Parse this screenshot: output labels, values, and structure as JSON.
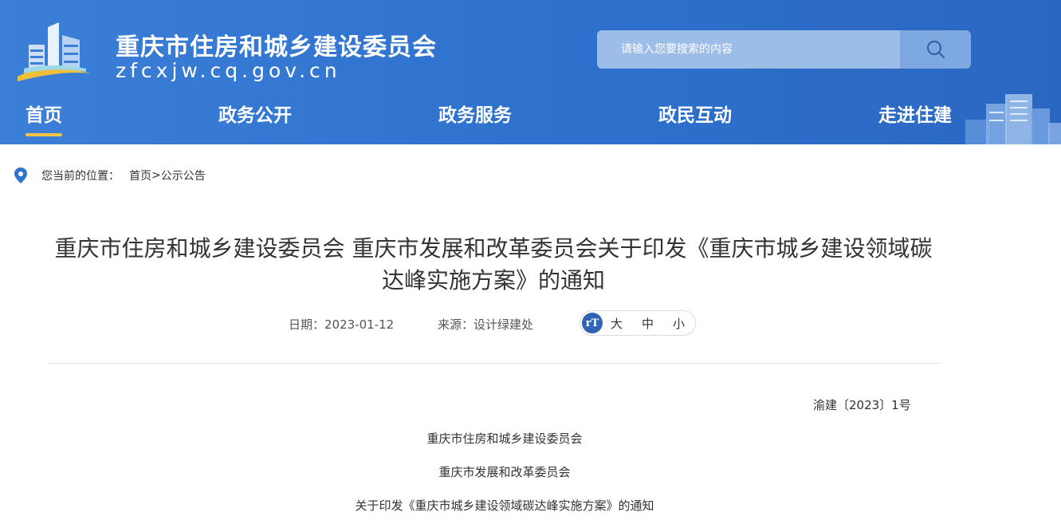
{
  "site": {
    "title": "重庆市住房和城乡建设委员会",
    "domain": "zfcxjw.cq.gov.cn"
  },
  "search": {
    "placeholder": "请输入您要搜索的内容",
    "button_icon": "search-icon"
  },
  "nav": {
    "items": [
      {
        "label": "首页",
        "active": true
      },
      {
        "label": "政务公开",
        "active": false
      },
      {
        "label": "政务服务",
        "active": false
      },
      {
        "label": "政民互动",
        "active": false
      },
      {
        "label": "走进住建",
        "active": false
      }
    ]
  },
  "breadcrumb": {
    "prefix": "您当前的位置：",
    "home": "首页",
    "separator": ">",
    "current": "公示公告",
    "icon": "location-pin-icon"
  },
  "article": {
    "title": "重庆市住房和城乡建设委员会 重庆市发展和改革委员会关于印发《重庆市城乡建设领域碳达峰实施方案》的通知",
    "date": "日期：2023-01-12",
    "source": "来源：设计绿建处",
    "font_size": {
      "icon_text": "rT",
      "large": "大",
      "medium": "中",
      "small": "小"
    },
    "doc_number": "渝建〔2023〕1号",
    "lines": [
      "重庆市住房和城乡建设委员会",
      "重庆市发展和改革委员会",
      "关于印发《重庆市城乡建设领域碳达峰实施方案》的通知"
    ]
  },
  "colors": {
    "header_blue": "#2f73cf",
    "nav_active_underline": "#f6c244",
    "font_icon_bg": "#2e63b6"
  }
}
